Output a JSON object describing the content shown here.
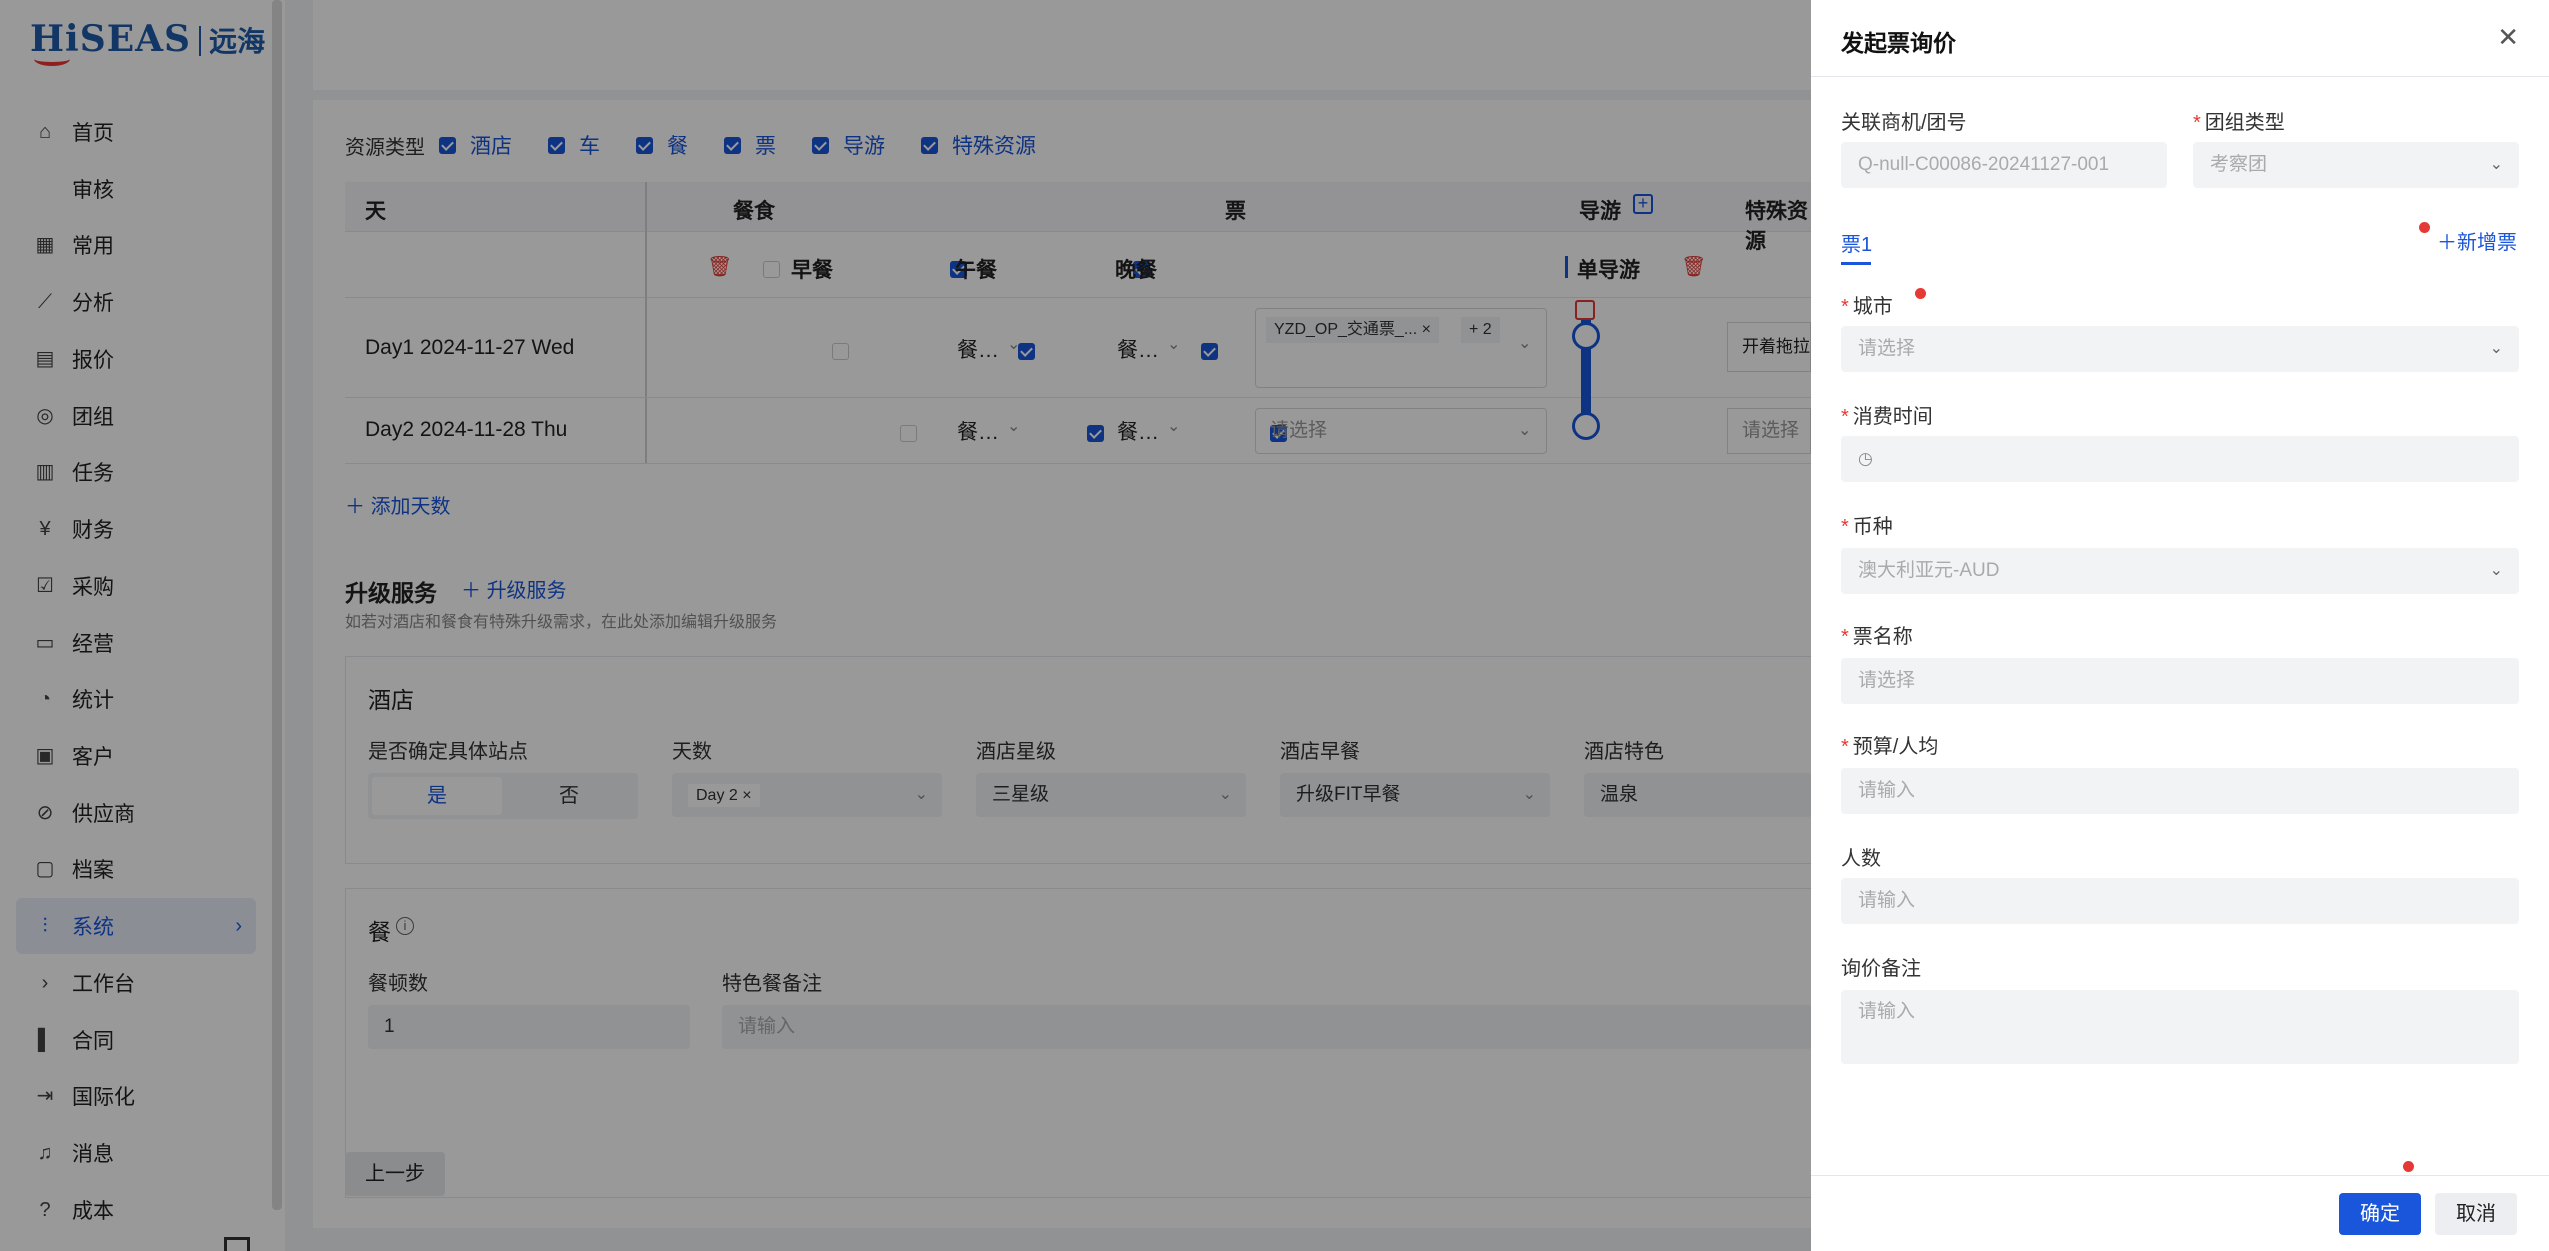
{
  "logo": {
    "brand": "HiSEAS",
    "cn": "远海"
  },
  "sidebar": {
    "items": [
      {
        "label": "首页",
        "icon": "home-icon"
      },
      {
        "label": "审核",
        "icon": ""
      },
      {
        "label": "常用",
        "icon": "grid-icon"
      },
      {
        "label": "分析",
        "icon": "chart-icon"
      },
      {
        "label": "报价",
        "icon": "quote-icon"
      },
      {
        "label": "团组",
        "icon": "group-icon"
      },
      {
        "label": "任务",
        "icon": "task-icon"
      },
      {
        "label": "财务",
        "icon": "yen-icon"
      },
      {
        "label": "采购",
        "icon": "cart-icon"
      },
      {
        "label": "经营",
        "icon": "monitor-icon"
      },
      {
        "label": "统计",
        "icon": "pie-icon"
      },
      {
        "label": "客户",
        "icon": "user-icon"
      },
      {
        "label": "供应商",
        "icon": "supplier-icon"
      },
      {
        "label": "档案",
        "icon": "folder-icon"
      },
      {
        "label": "系统",
        "icon": "settings-icon"
      },
      {
        "label": "工作台",
        "icon": "chevron-right-icon"
      },
      {
        "label": "合同",
        "icon": "contract-icon"
      },
      {
        "label": "国际化",
        "icon": "export-icon"
      },
      {
        "label": "消息",
        "icon": "bell-icon"
      },
      {
        "label": "成本",
        "icon": "help-icon"
      }
    ]
  },
  "resources": {
    "label": "资源类型",
    "options": [
      "酒店",
      "车",
      "餐",
      "票",
      "导游",
      "特殊资源"
    ]
  },
  "table": {
    "headers": {
      "day": "天",
      "meal": "餐食",
      "ticket": "票",
      "guide": "导游",
      "special": "特殊资源"
    },
    "meal_sub": {
      "breakfast": "早餐",
      "lunch": "午餐",
      "dinner": "晚餐"
    },
    "guide_sub": "单导游",
    "rows": [
      {
        "day": "Day1 2024-11-27 Wed",
        "lunch": "餐…",
        "dinner": "餐…",
        "ticket_tag": "YZD_OP_交通票_...",
        "ticket_more": "+ 2",
        "special": "开着拖拉机"
      },
      {
        "day": "Day2 2024-11-28 Thu",
        "lunch": "餐…",
        "dinner": "餐…",
        "ticket_placeholder": "请选择",
        "special_placeholder": "请选择"
      }
    ],
    "add_days": "添加天数"
  },
  "upgrade": {
    "title": "升级服务",
    "add": "升级服务",
    "desc": "如若对酒店和餐食有特殊升级需求，在此处添加编辑升级服务",
    "hotel": {
      "title": "酒店",
      "site_label": "是否确定具体站点",
      "yes": "是",
      "no": "否",
      "days_label": "天数",
      "days_tag": "Day 2",
      "star_label": "酒店星级",
      "star_value": "三星级",
      "breakfast_label": "酒店早餐",
      "breakfast_value": "升级FIT早餐",
      "feature_label": "酒店特色",
      "feature_value": "温泉"
    },
    "meal": {
      "title": "餐",
      "count_label": "餐顿数",
      "count_value": "1",
      "remark_label": "特色餐备注",
      "remark_placeholder": "请输入"
    }
  },
  "prev_button": "上一步",
  "drawer": {
    "title": "发起票询价",
    "link_label": "关联商机/团号",
    "link_value": "Q-null-C00086-20241127-001",
    "group_type_label": "团组类型",
    "group_type_value": "考察团",
    "tab": "票1",
    "add_ticket": "新增票",
    "city_label": "城市",
    "city_placeholder": "请选择",
    "time_label": "消费时间",
    "currency_label": "币种",
    "currency_value": "澳大利亚元-AUD",
    "ticket_name_label": "票名称",
    "ticket_name_placeholder": "请选择",
    "budget_label": "预算/人均",
    "budget_placeholder": "请输入",
    "people_label": "人数",
    "people_placeholder": "请输入",
    "remark_label": "询价备注",
    "remark_placeholder": "请输入",
    "confirm": "确定",
    "cancel": "取消"
  },
  "colors": {
    "primary": "#1a56db",
    "required": "#e53935",
    "overlay": "rgba(0,0,0,0.4)"
  }
}
